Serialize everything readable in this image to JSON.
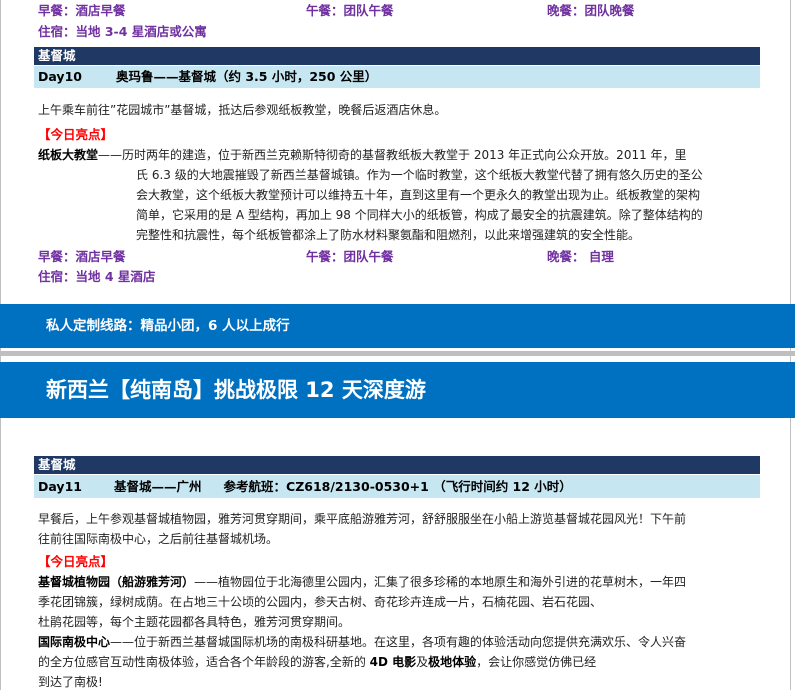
{
  "top_meals": {
    "breakfast": "早餐：酒店早餐",
    "lunch": "午餐：团队午餐",
    "dinner": "晚餐：团队晚餐"
  },
  "top_lodging": "住宿：当地 3-4 星酒店或公寓",
  "day10": {
    "city": "基督城",
    "day": "Day10",
    "route": "奥玛鲁——基督城（约 3.5 小时，250 公里）",
    "intro": "上午乘车前往”花园城市”基督城，抵达后参观纸板教堂，晚餐后返酒店休息。",
    "highlight": "【今日亮点】",
    "attraction_name": "纸板大教堂",
    "attraction_lines": [
      "——历时两年的建造，位于新西兰克赖斯特彻奇的基督教纸板大教堂于 2013 年正式向公众开放。2011 年，里",
      "氏 6.3 级的大地震摧毁了新西兰基督城镇。作为一个临时教堂，这个纸板大教堂代替了拥有悠久历史的圣公",
      "会大教堂，这个纸板大教堂预计可以维持五十年，直到这里有一个更永久的教堂出现为止。纸板教堂的架构",
      "简单，它采用的是 A 型结构，再加上 98 个同样大小的纸板管，构成了最安全的抗震建筑。除了整体结构的",
      "完整性和抗震性，每个纸板管都涂上了防水材料聚氨酯和阻燃剂，以此来增强建筑的安全性能。"
    ],
    "meals": {
      "breakfast": "早餐：酒店早餐",
      "lunch": "午餐：团队午餐",
      "dinner": "晚餐：  自理"
    },
    "lodging": "住宿：当地 4 星酒店"
  },
  "private_banner": "私人定制线路：精品小团，6 人以上成行",
  "tour_title": "新西兰【纯南岛】挑战极限 12 天深度游",
  "day11": {
    "city": "基督城",
    "day": "Day11",
    "route": "基督城——广州",
    "flight": "参考航班：CZ618/2130-0530+1  （飞行时间约 12 小时）",
    "intro_lines": [
      "早餐后，上午参观基督城植物园，雅芳河贯穿期间，乘平底船游雅芳河，舒舒服服坐在小船上游览基督城花园风光！下午前",
      "往前往国际南极中心，之后前往基督城机场。"
    ],
    "highlight": "【今日亮点】",
    "attraction1_name": "基督城植物园（船游雅芳河）",
    "attraction1_lines": [
      "——植物园位于北海德里公园内，汇集了很多珍稀的本地原生和海外引进的花草树木，一年四",
      "季花团锦簇，绿树成荫。在占地三十公顷的公园内，参天古树、奇花珍卉连成一片，石楠花园、岩石花园、",
      "杜鹃花园等，每个主题花园都各具特色，雅芳河贯穿期间。"
    ],
    "attraction2_name": "国际南极中心",
    "attraction2_line1": "——位于新西兰基督城国际机场的南极科研基地。在这里，各项有趣的体验活动向您提供充满欢乐、令人兴奋",
    "attraction2_line2_a": "的全方位感官互动性南极体验，适合各个年龄段的游客,全新的 ",
    "attraction2_line2_b1": "4D 电影",
    "attraction2_line2_c": "及",
    "attraction2_line2_b2": "极地体验",
    "attraction2_line2_d": "，会让你感觉仿佛已经",
    "attraction2_line3": "到达了南极!"
  },
  "colors": {
    "accent_blue": "#0070c0",
    "city_bar": "#1f3864",
    "day_bar": "#c6e7f2",
    "meal_purple": "#7030a0",
    "highlight_red": "#ff0000"
  }
}
